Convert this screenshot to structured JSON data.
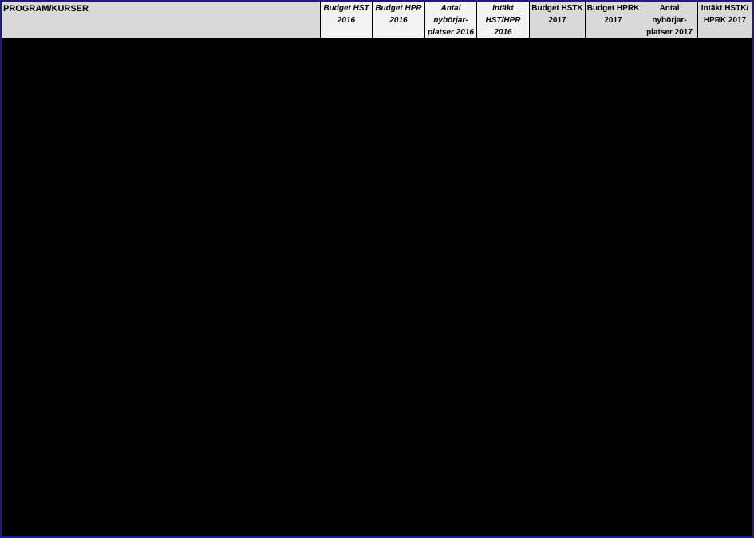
{
  "table": {
    "headers": [
      "PROGRAM/KURSER",
      "Budget HST\n2016",
      "Budget HPR\n2016",
      "Antal\nnybörjar-\nplatser 2016",
      "Intäkt\nHST/HPR\n2016",
      "Budget HSTK\n2017",
      "Budget HPRK\n2017",
      "Antal\nnybörjar-\nplatser 2017",
      "Intäkt HSTK/\nHPRK 2017"
    ]
  },
  "colors": {
    "border": "#1a1a8c",
    "header_bg_main": "#d9d9d9",
    "header_bg_2016": "#f2f2f2",
    "header_bg_2017": "#d9d9d9",
    "body_bg": "#000000"
  }
}
